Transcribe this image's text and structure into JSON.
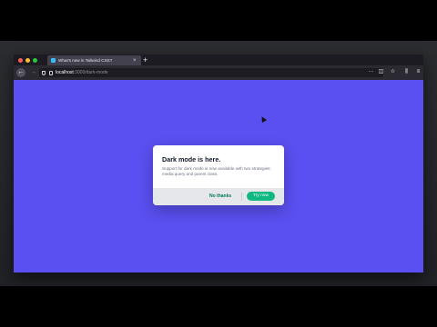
{
  "browser": {
    "tab_title": "What's new in Tailwind CSS?",
    "tab_close": "×",
    "new_tab": "+",
    "url_host": "localhost",
    "url_path": ":3000/dark-mode",
    "icons": {
      "back": "←",
      "forward": "→",
      "more": "···",
      "pocket": "◫",
      "star": "☆",
      "library": "⫼",
      "menu": "≡"
    }
  },
  "page": {
    "background_color": "#5a4ff0"
  },
  "modal": {
    "title": "Dark mode is here.",
    "body": "Support for dark mode is now available with two strategies: media query and parent class.",
    "secondary_label": "No thanks",
    "primary_label": "Try now",
    "accent_color": "#10b981"
  }
}
